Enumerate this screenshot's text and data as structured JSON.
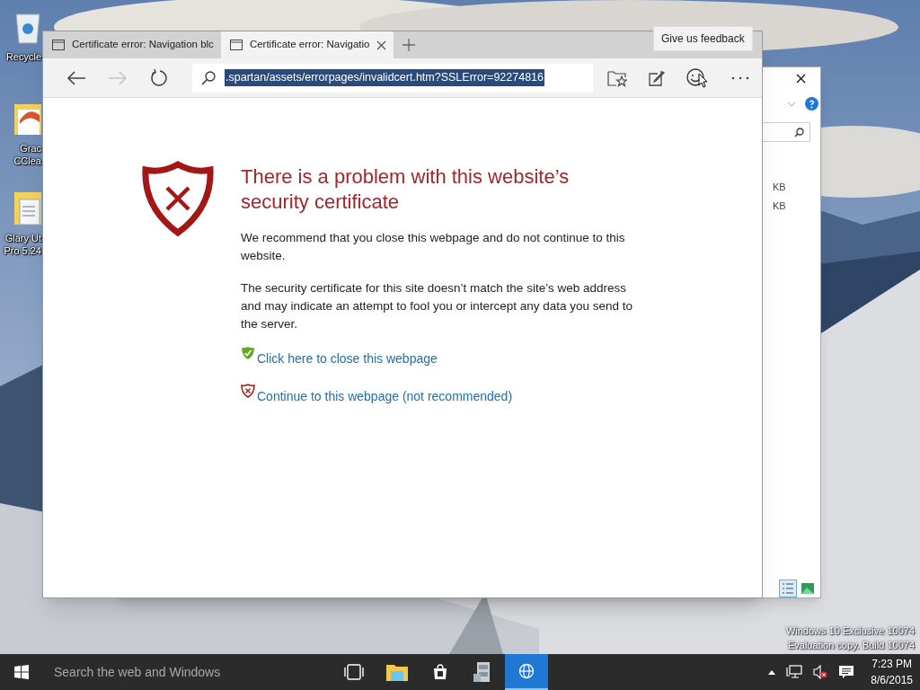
{
  "desktop": {
    "icons": [
      {
        "kind": "recycle-bin",
        "lines": [
          "Recycle"
        ]
      },
      {
        "kind": "app",
        "lines": [
          "Grac",
          "CClea"
        ]
      },
      {
        "kind": "document",
        "lines": [
          "Glary Ut",
          "Pro 5.24"
        ]
      }
    ],
    "evaluation_text": [
      "Windows 10 Exclusive 10074",
      "Evaluation copy. Build 10074"
    ]
  },
  "back_window": {
    "sizes": [
      "KB",
      "KB"
    ]
  },
  "browser": {
    "tabs": [
      {
        "title": "Certificate error: Navigation blc",
        "selected": false
      },
      {
        "title": "Certificate error: Navigatio",
        "selected": true
      }
    ],
    "nav_buttons": [
      {
        "kind": "back",
        "disabled": false
      },
      {
        "kind": "forward",
        "disabled": true
      },
      {
        "kind": "refresh",
        "disabled": false
      }
    ],
    "address": {
      "value": ".spartan/assets/errorpages/invalidcert.htm?SSLError=92274816",
      "highlighted": true
    },
    "tooltip": "Give us feedback",
    "page": {
      "title": "There is a problem with this website’s security certificate",
      "paragraphs": [
        "We recommend that you close this webpage and do not continue to this website.",
        "The security certificate for this site doesn’t match the site’s web address and may indicate an attempt to fool you or intercept any data you send to the server."
      ],
      "links": [
        {
          "kind": "safe",
          "text": "Click here to close this webpage"
        },
        {
          "kind": "unsafe",
          "text": "Continue to this webpage (not recommended)"
        }
      ]
    }
  },
  "taskbar": {
    "search_placeholder": "Search the web and Windows",
    "apps": [
      {
        "kind": "task-view",
        "selected": false
      },
      {
        "kind": "explorer",
        "selected": false
      },
      {
        "kind": "store",
        "selected": false
      },
      {
        "kind": "cabinet",
        "selected": false
      },
      {
        "kind": "browser",
        "selected": true
      }
    ],
    "volume_muted": true,
    "time": "7:23 PM",
    "date": "8/6/2015"
  }
}
